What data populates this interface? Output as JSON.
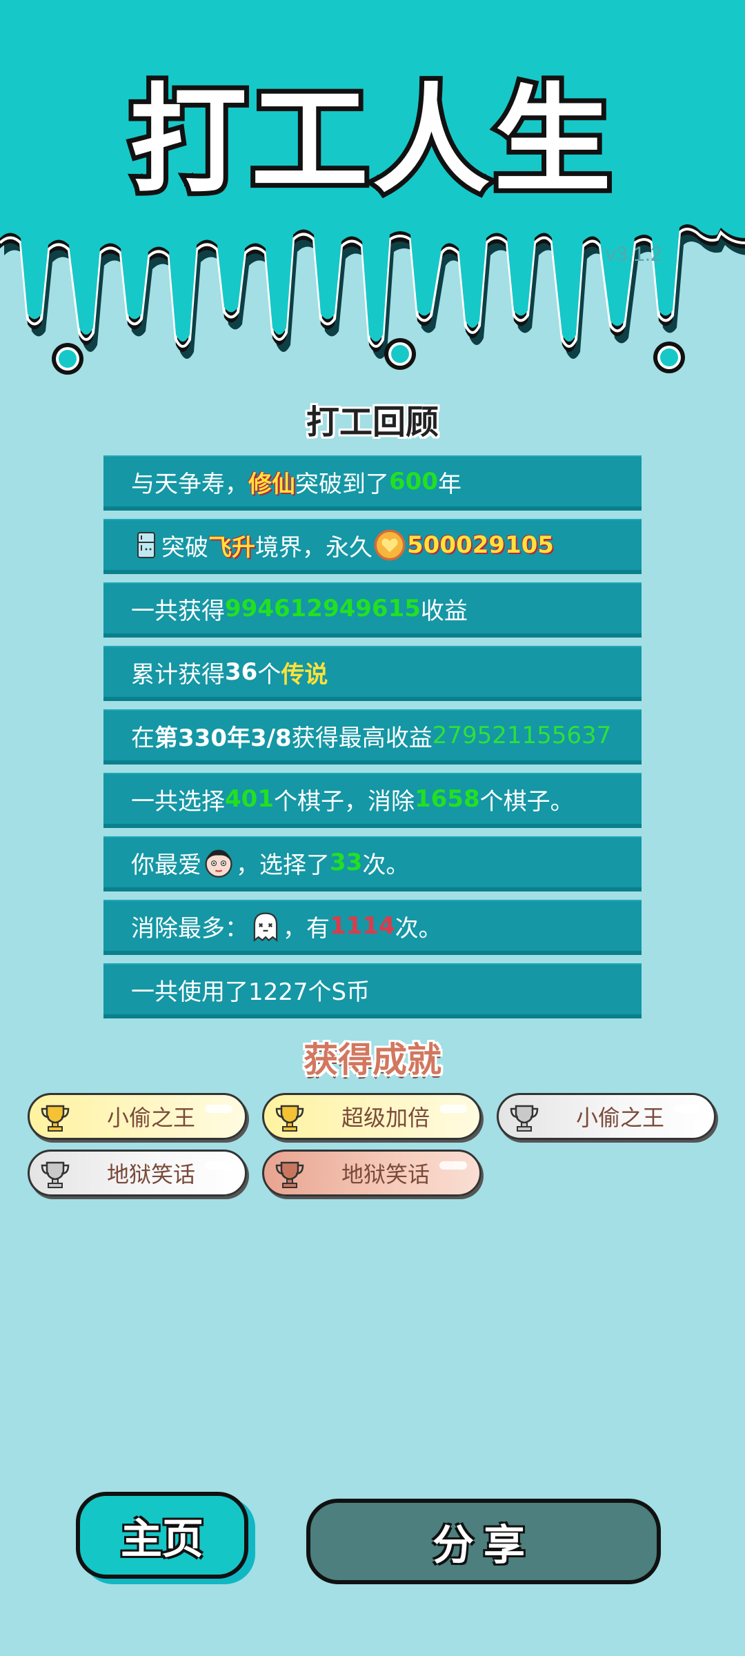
{
  "app": {
    "title": "打工人生",
    "version": "v3.1.2"
  },
  "colors": {
    "header_teal": "#17c8c8",
    "background": "#a3dfe5",
    "row_bg": "#1597a5",
    "highlight_green": "#22e022",
    "highlight_yellow": "#ffe23a",
    "highlight_red": "#e03a4a"
  },
  "review": {
    "title": "打工回顾",
    "rows": [
      {
        "parts": [
          "与天争寿，",
          "修仙",
          "突破到了",
          "600",
          "年"
        ]
      },
      {
        "icon": "fridge-icon",
        "parts": [
          "突破",
          "飞升",
          "境界，永久",
          "500029105"
        ],
        "coin_icon": "heart-coin-icon"
      },
      {
        "parts": [
          "一共获得",
          "994612949615",
          "收益"
        ]
      },
      {
        "parts": [
          "累计获得",
          "36",
          "个",
          "传说"
        ]
      },
      {
        "parts": [
          "在 ",
          "第330年3/8",
          " 获得最高收益",
          "279521155637"
        ]
      },
      {
        "parts": [
          "一共选择",
          "401",
          "个棋子，消除",
          "1658",
          "个棋子。"
        ]
      },
      {
        "icon": "man-face-icon",
        "parts": [
          "你最爱",
          "，选择了",
          "33",
          "次。"
        ]
      },
      {
        "icon": "ghost-icon",
        "parts": [
          "消除最多：",
          "，有",
          "1114",
          "次。"
        ]
      },
      {
        "parts": [
          "一共使用了1227个S币"
        ]
      }
    ]
  },
  "achievements": {
    "title": "获得成就",
    "items": [
      {
        "label": "小偷之王",
        "tier": "gold",
        "icon": "trophy-icon"
      },
      {
        "label": "超级加倍",
        "tier": "gold",
        "icon": "trophy-icon"
      },
      {
        "label": "小偷之王",
        "tier": "silver",
        "icon": "trophy-icon"
      },
      {
        "label": "地狱笑话",
        "tier": "silver",
        "icon": "trophy-icon"
      },
      {
        "label": "地狱笑话",
        "tier": "bronze",
        "icon": "trophy-icon"
      }
    ]
  },
  "buttons": {
    "home": "主页",
    "share": "分享"
  }
}
